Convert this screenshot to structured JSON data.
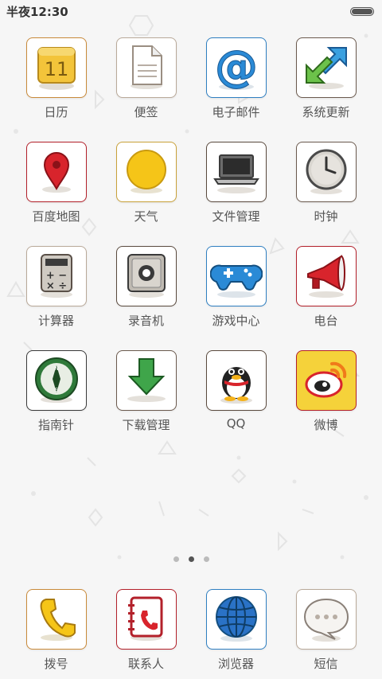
{
  "status_bar": {
    "time": "半夜12:30"
  },
  "apps": [
    {
      "label": "日历",
      "icon": "calendar-icon",
      "border": "#c98a3a",
      "day": "11"
    },
    {
      "label": "便签",
      "icon": "notes-icon",
      "border": "#b9a999"
    },
    {
      "label": "电子邮件",
      "icon": "email-icon",
      "border": "#2f7fc1"
    },
    {
      "label": "系统更新",
      "icon": "system-update-icon",
      "border": "#6b5a4e"
    },
    {
      "label": "百度地图",
      "icon": "map-pin-icon",
      "border": "#b3202a"
    },
    {
      "label": "天气",
      "icon": "weather-sun-icon",
      "border": "#c9a23a"
    },
    {
      "label": "文件管理",
      "icon": "laptop-icon",
      "border": "#5a4a3e"
    },
    {
      "label": "时钟",
      "icon": "clock-icon",
      "border": "#6b5a4e"
    },
    {
      "label": "计算器",
      "icon": "calculator-icon",
      "border": "#b9a999"
    },
    {
      "label": "录音机",
      "icon": "recorder-icon",
      "border": "#5a4a3e"
    },
    {
      "label": "游戏中心",
      "icon": "gamepad-icon",
      "border": "#2f7fc1"
    },
    {
      "label": "电台",
      "icon": "megaphone-icon",
      "border": "#b3202a"
    },
    {
      "label": "指南针",
      "icon": "compass-icon",
      "border": "#3a3a3a"
    },
    {
      "label": "下载管理",
      "icon": "download-arrow-icon",
      "border": "#6b5a4e"
    },
    {
      "label": "QQ",
      "icon": "qq-penguin-icon",
      "border": "#5a4a3e"
    },
    {
      "label": "微博",
      "icon": "weibo-icon",
      "border": "#b3202a"
    }
  ],
  "page_indicator": {
    "count": 3,
    "active": 2
  },
  "dock": [
    {
      "label": "拨号",
      "icon": "phone-icon",
      "border": "#c98a3a"
    },
    {
      "label": "联系人",
      "icon": "contacts-book-icon",
      "border": "#b3202a"
    },
    {
      "label": "浏览器",
      "icon": "globe-icon",
      "border": "#2f7fc1"
    },
    {
      "label": "短信",
      "icon": "message-bubble-icon",
      "border": "#b9a999"
    }
  ]
}
